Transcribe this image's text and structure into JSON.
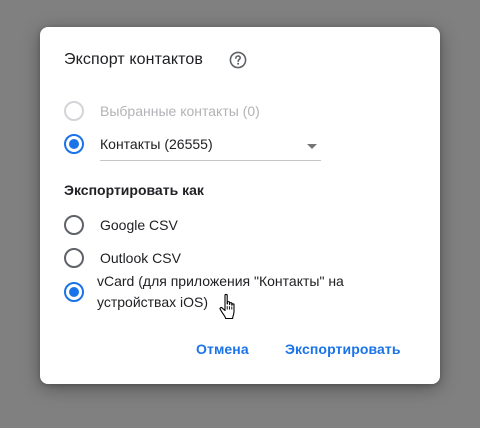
{
  "dialog": {
    "title": "Экспорт контактов",
    "help_icon": "help-circle-icon",
    "contacts_options": [
      {
        "label": "Выбранные контакты (0)",
        "checked": false,
        "disabled": true
      },
      {
        "label": "Контакты (26555)",
        "checked": true,
        "disabled": false
      }
    ],
    "contacts_select_value": "Контакты (26555)",
    "export_as_heading": "Экспортировать как",
    "format_options": [
      {
        "label": "Google CSV",
        "checked": false
      },
      {
        "label": "Outlook CSV",
        "checked": false
      },
      {
        "label": "vCard (для приложения \"Контакты\" на устройствах iOS)",
        "checked": true
      }
    ],
    "cancel_label": "Отмена",
    "export_label": "Экспортировать"
  },
  "colors": {
    "accent": "#1a73e8",
    "backdrop": "#808080",
    "text": "#202124",
    "disabled_text": "#b1b3b6"
  }
}
